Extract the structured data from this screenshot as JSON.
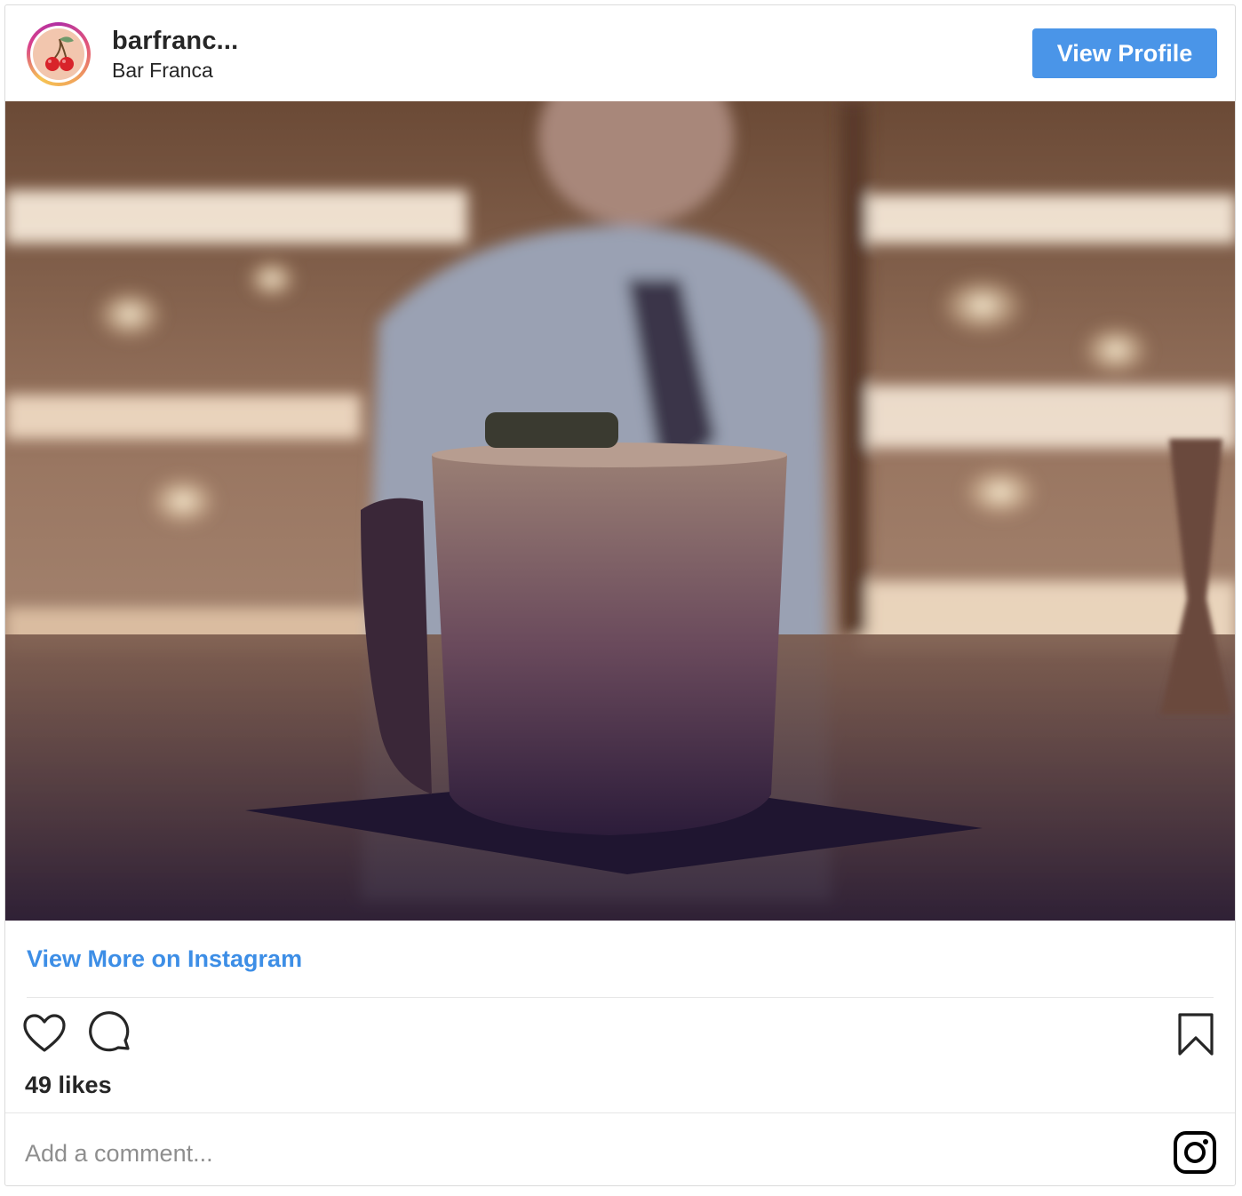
{
  "header": {
    "username": "barfranc...",
    "full_name": "Bar Franca",
    "view_profile_label": "View Profile"
  },
  "post": {
    "image_icon": "photo",
    "view_more_label": "View More on Instagram",
    "likes_text": "49 likes"
  },
  "actions": {
    "like_icon": "heart-icon",
    "comment_icon": "comment-icon",
    "save_icon": "bookmark-icon"
  },
  "comment_box": {
    "placeholder": "Add a comment...",
    "value": ""
  },
  "colors": {
    "accent": "#4a95e8",
    "link": "#3d8ee6",
    "text": "#262626",
    "muted": "#8e8e8e"
  }
}
